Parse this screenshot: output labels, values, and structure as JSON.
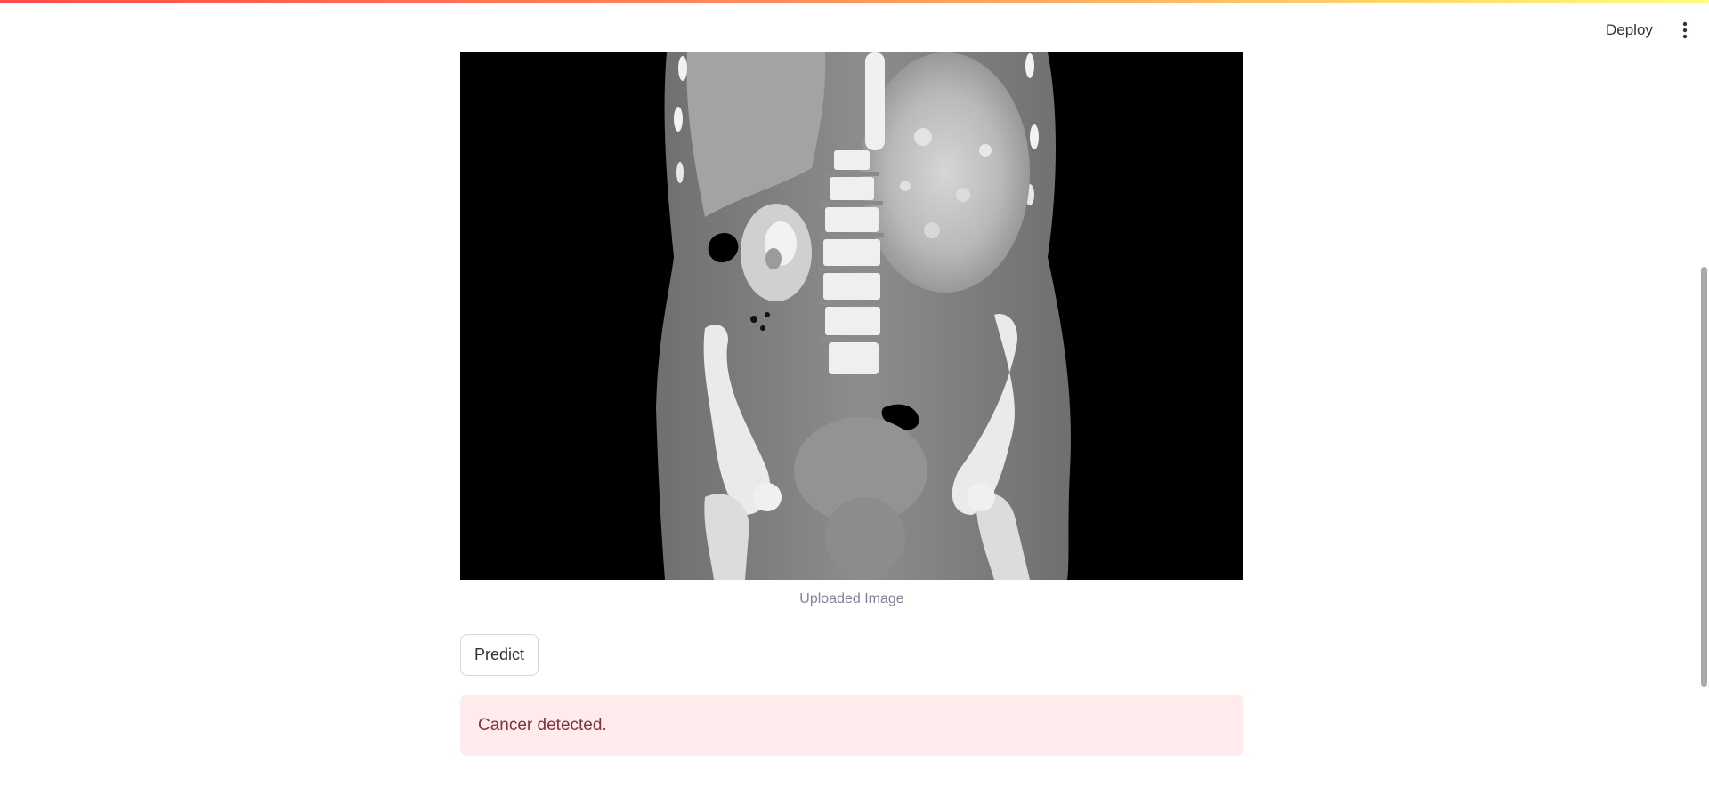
{
  "header": {
    "deploy_label": "Deploy",
    "menu_icon": "vertical-ellipsis-icon"
  },
  "main": {
    "image": {
      "description_icon": "ct-scan-image",
      "caption": "Uploaded Image"
    },
    "predict_label": "Predict",
    "result": {
      "message": "Cancer detected.",
      "status_color": "#ffebeb",
      "text_color": "#7d353b"
    }
  },
  "colors": {
    "accent": "#ff4b4b",
    "background": "#ffffff",
    "text": "#31333f",
    "caption": "#808495"
  }
}
